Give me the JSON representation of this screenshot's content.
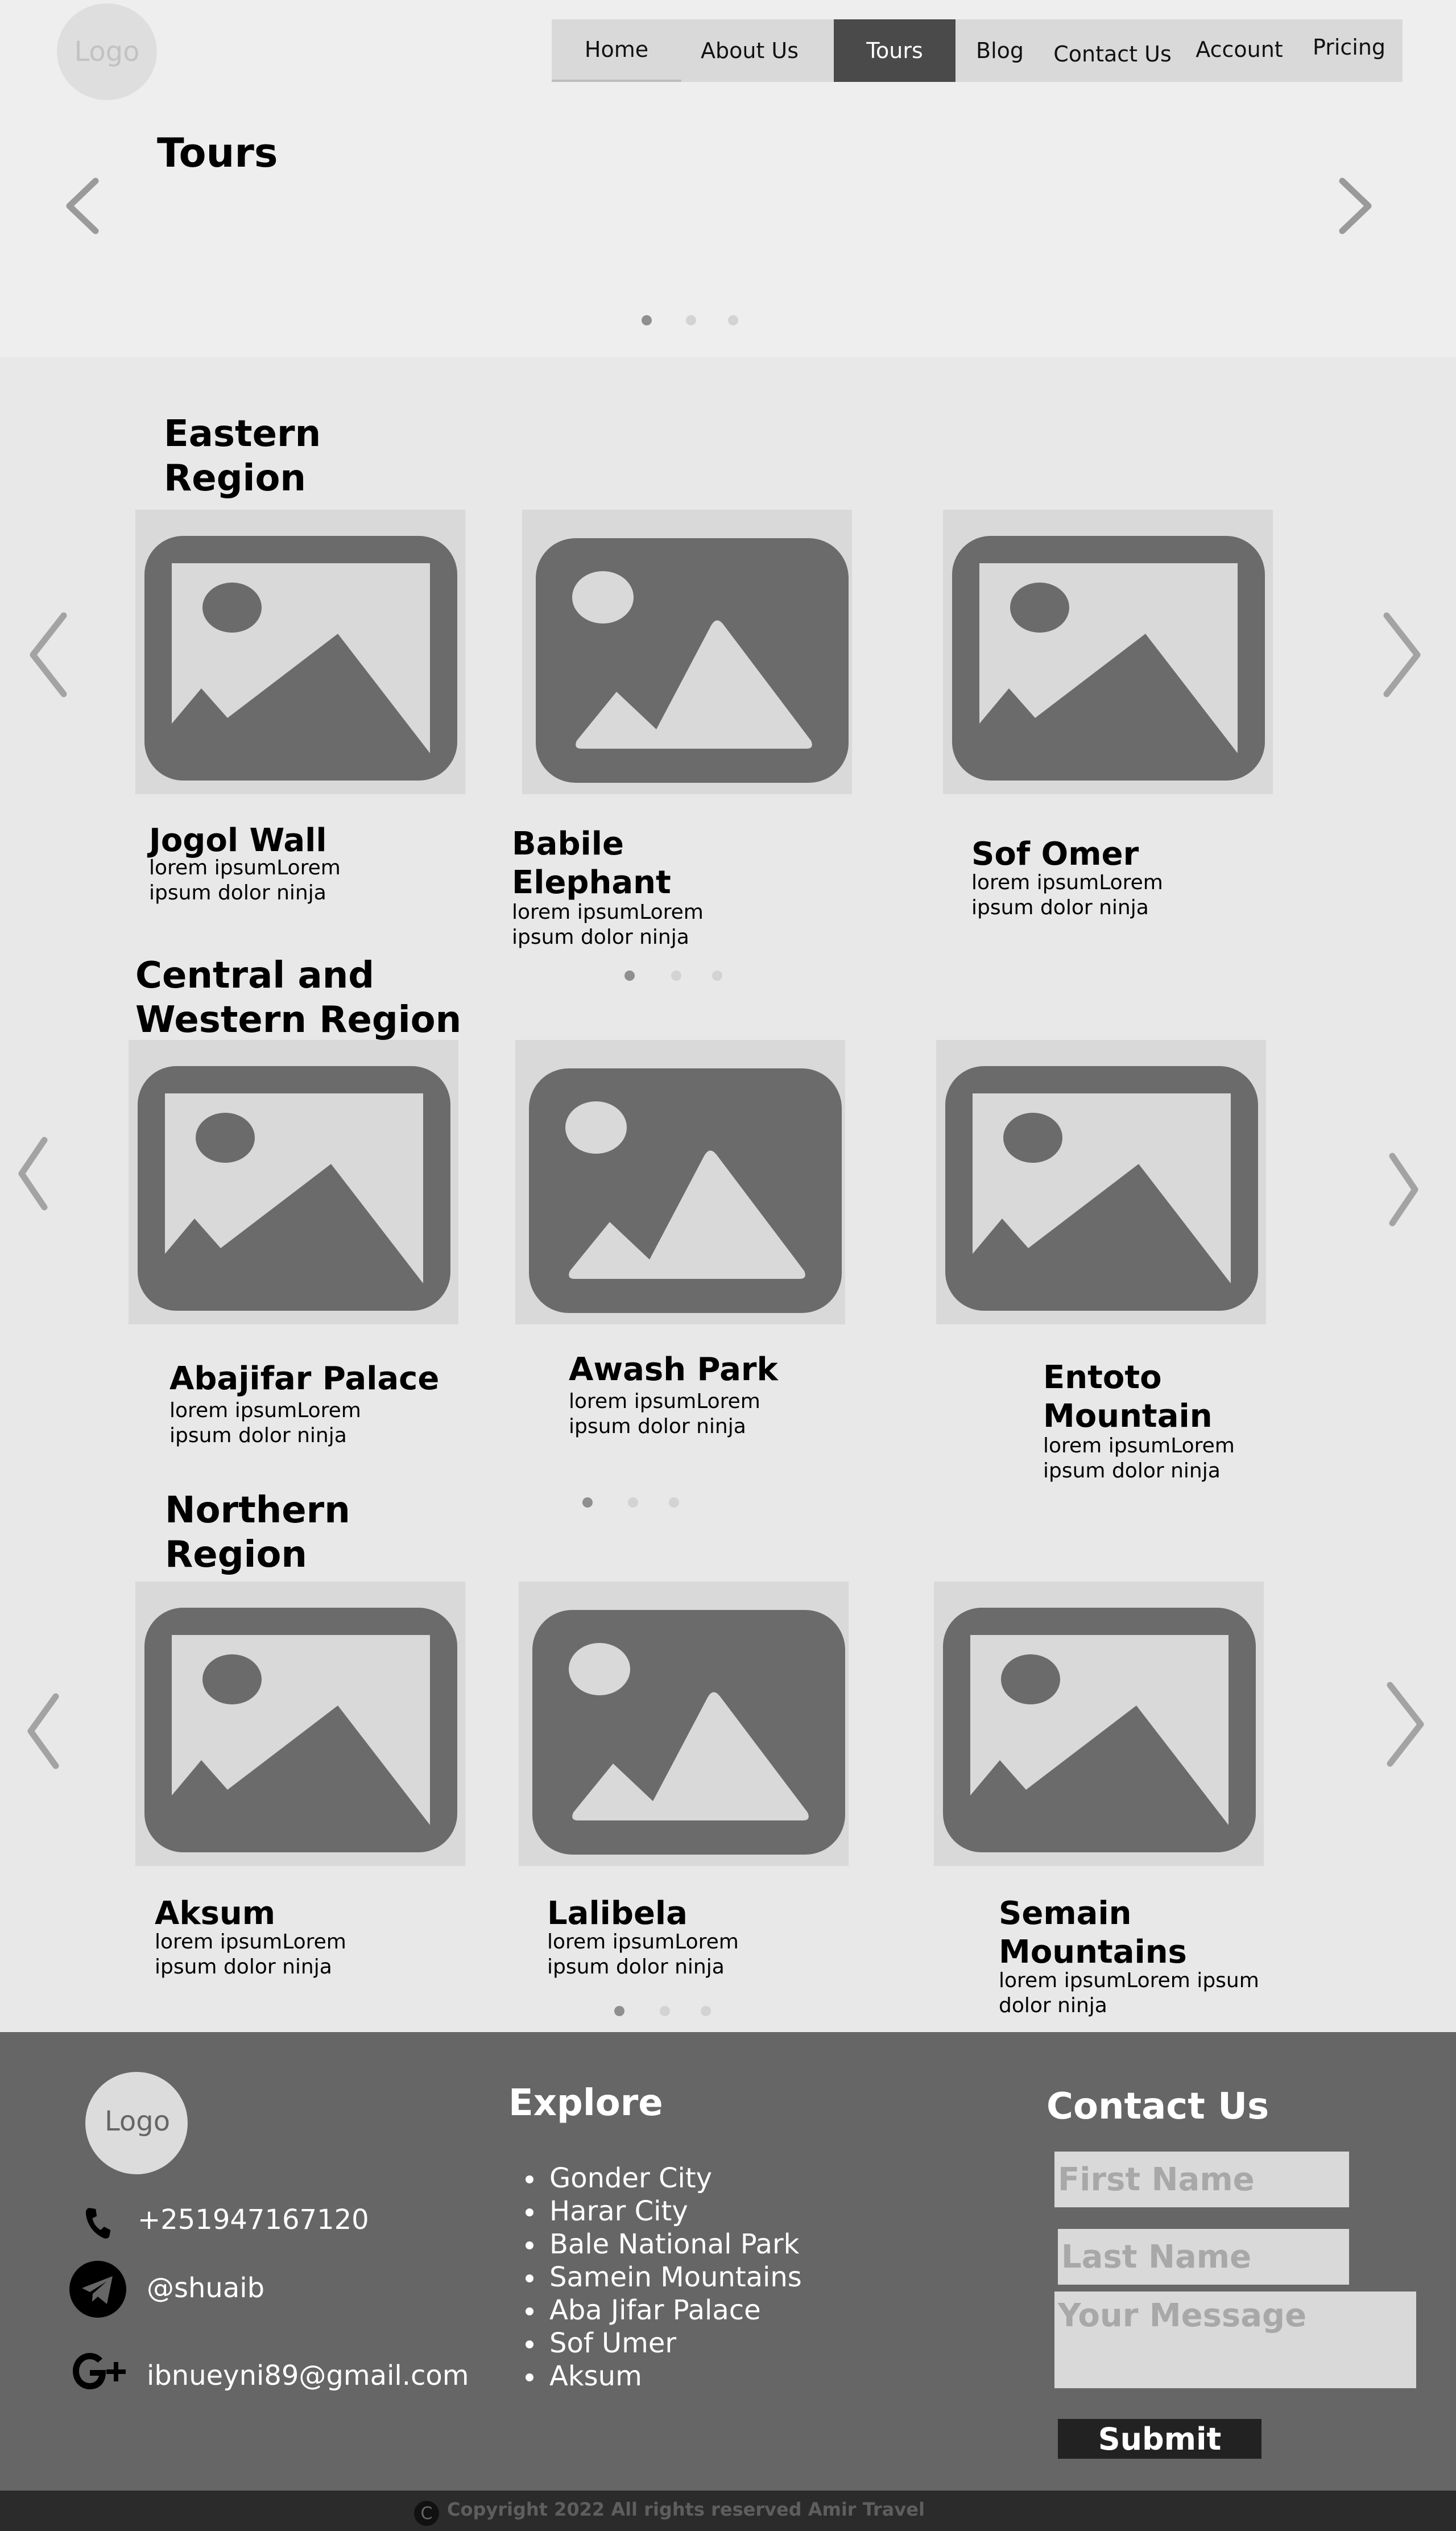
{
  "header": {
    "logo_text": "Logo",
    "nav": [
      {
        "label": "Home"
      },
      {
        "label": "About Us"
      },
      {
        "label": "Tours",
        "active": true
      },
      {
        "label": "Blog"
      },
      {
        "label": "Contact Us"
      },
      {
        "label": "Account"
      },
      {
        "label": "Pricing"
      }
    ]
  },
  "hero": {
    "title": "Tours",
    "carousel_pages": 3,
    "active_page": 1
  },
  "regions": [
    {
      "title": "Eastern Region",
      "cards": [
        {
          "title": "Jogol Wall",
          "description": "lorem ipsumLorem ipsum dolor ninja"
        },
        {
          "title": "Babile Elephant",
          "description": "lorem ipsumLorem ipsum dolor ninja"
        },
        {
          "title": "Sof Omer",
          "description": "lorem ipsumLorem ipsum dolor ninja"
        }
      ]
    },
    {
      "title": "Central and Western Region",
      "cards": [
        {
          "title": "Abajifar Palace",
          "description": "lorem ipsumLorem ipsum dolor ninja"
        },
        {
          "title": "Awash Park",
          "description": "lorem ipsumLorem ipsum dolor ninja"
        },
        {
          "title": "Entoto Mountain",
          "description": "lorem ipsumLorem ipsum dolor ninja"
        }
      ]
    },
    {
      "title": "Northern Region",
      "cards": [
        {
          "title": "Aksum",
          "description": "lorem ipsumLorem ipsum dolor ninja"
        },
        {
          "title": "Lalibela",
          "description": "lorem ipsumLorem ipsum dolor ninja"
        },
        {
          "title": "Semain Mountains",
          "description": "lorem ipsumLorem ipsum dolor ninja"
        }
      ]
    }
  ],
  "footer": {
    "logo_text": "Logo",
    "phone": "+251947167120",
    "telegram": "@shuaib",
    "email": "ibnueyni89@gmail.com",
    "explore_title": "Explore",
    "explore_items": [
      "Gonder City",
      "Harar City",
      "Bale National Park",
      "Samein Mountains",
      "Aba Jifar Palace",
      "Sof Umer",
      "Aksum"
    ],
    "contact_title": "Contact Us",
    "first_name_placeholder": "First Name",
    "last_name_placeholder": "Last Name",
    "message_placeholder": "Your Message",
    "submit_label": "Submit",
    "copyright_symbol": "C",
    "copyright": "Copyright 2022 All rights reserved Amir Travel"
  },
  "colors": {
    "page_bg": "#e8e8e8",
    "hero_bg": "#eeeeee",
    "nav_bg": "#d9d9d9",
    "nav_active": "#4a4a4a",
    "image_icon": "#6b6b6b",
    "image_bg": "#d9d9d9",
    "footer_bg": "#666666",
    "copyright_bar": "#2b2b2b"
  },
  "icons": [
    "chevron-left-icon",
    "chevron-right-icon",
    "image-placeholder-icon",
    "phone-icon",
    "telegram-icon",
    "google-plus-icon",
    "copyright-icon"
  ]
}
